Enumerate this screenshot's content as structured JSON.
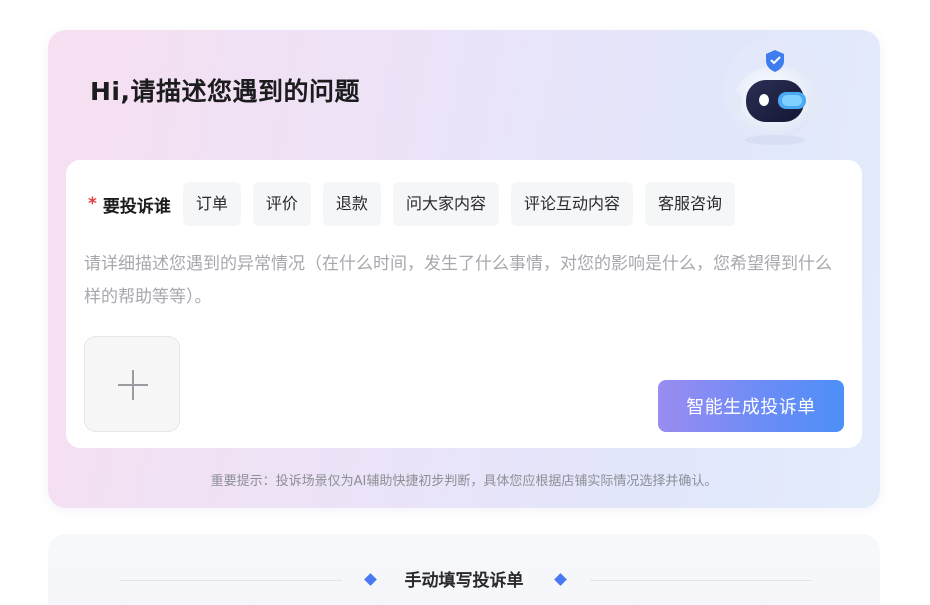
{
  "header": {
    "title": "Hi,请描述您遇到的问题"
  },
  "complaint": {
    "target_label": "要投诉谁",
    "required_mark": "*",
    "chips": [
      {
        "label": "订单"
      },
      {
        "label": "评价"
      },
      {
        "label": "退款"
      },
      {
        "label": "问大家内容"
      },
      {
        "label": "评论互动内容"
      },
      {
        "label": "客服咨询"
      }
    ],
    "description_placeholder": "请详细描述您遇到的异常情况（在什么时间，发生了什么事情，对您的影响是什么，您希望得到什么样的帮助等等）。",
    "upload_icon": "plus-icon",
    "generate_button_label": "智能生成投诉单",
    "hint": "重要提示：投诉场景仅为AI辅助快捷初步判断，具体您应根据店铺实际情况选择并确认。"
  },
  "manual": {
    "title": "手动填写投诉单"
  },
  "colors": {
    "accent_blue": "#4d8ff7",
    "accent_purple": "#9a8cf0",
    "required_red": "#e23b3b",
    "card_gradient_start": "#f6dff0",
    "card_gradient_end": "#e4ecfb"
  }
}
